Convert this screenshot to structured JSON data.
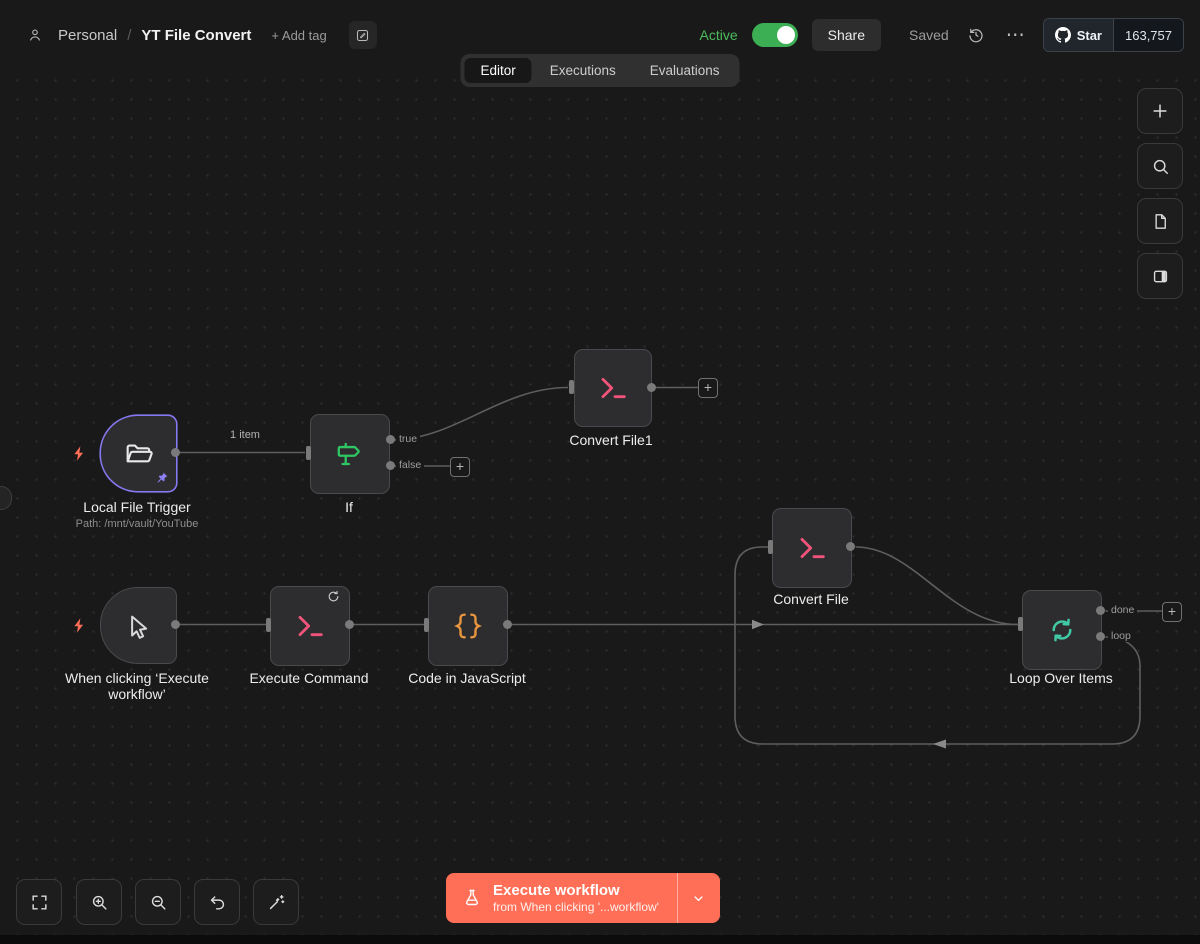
{
  "header": {
    "project": "Personal",
    "separator": "/",
    "title": "YT File Convert",
    "add_tag": "+ Add tag",
    "active_label": "Active",
    "share": "Share",
    "saved": "Saved",
    "github_star": "Star",
    "github_count": "163,757"
  },
  "tabs": {
    "editor": "Editor",
    "executions": "Executions",
    "evaluations": "Evaluations"
  },
  "nodes": {
    "local_file_trigger": {
      "label": "Local File Trigger",
      "sublabel": "Path: /mnt/vault/YouTube"
    },
    "if_node": {
      "label": "If"
    },
    "convert_file1": {
      "label": "Convert File1"
    },
    "manual_trigger": {
      "label_line1": "When clicking ‘Execute",
      "label_line2": "workflow’"
    },
    "execute_command": {
      "label": "Execute Command"
    },
    "code_in_javascript": {
      "label": "Code in JavaScript"
    },
    "convert_file": {
      "label": "Convert File"
    },
    "loop_over_items": {
      "label": "Loop Over Items"
    }
  },
  "connections": {
    "item_count": "1 item",
    "true_label": "true",
    "false_label": "false",
    "done_label": "done",
    "loop_label": "loop"
  },
  "execute_bar": {
    "title": "Execute workflow",
    "subtitle": "from When clicking '...workflow'"
  },
  "icons": {
    "plus": "+",
    "menu_dots": "⋯"
  },
  "colors": {
    "accent": "#ff6e56",
    "active_green": "#4cbb5c",
    "node_pink": "#f0547a",
    "node_orange": "#e8963e",
    "node_teal": "#41c8a5",
    "node_green": "#2fc763",
    "selected_violet": "#8678f0"
  }
}
